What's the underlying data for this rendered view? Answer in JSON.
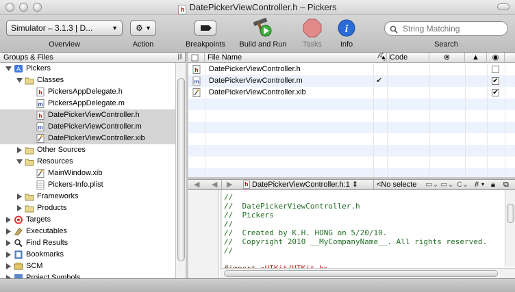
{
  "window": {
    "title": "DatePickerViewController.h – Pickers",
    "doc_badge": "h"
  },
  "toolbar": {
    "overview_value": "Simulator – 3.1.3 | D...",
    "overview_label": "Overview",
    "action_label": "Action",
    "breakpoints_label": "Breakpoints",
    "build_run_label": "Build and Run",
    "tasks_label": "Tasks",
    "info_label": "Info",
    "search_placeholder": "String Matching",
    "search_label": "Search"
  },
  "sidebar": {
    "header": "Groups & Files",
    "items": [
      {
        "label": "Pickers",
        "icon": "project-icon",
        "disclosure": "open"
      },
      {
        "label": "Classes",
        "icon": "folder-icon",
        "disclosure": "open"
      },
      {
        "label": "PickersAppDelegate.h",
        "icon": "header-file-icon",
        "badge": "h"
      },
      {
        "label": "PickersAppDelegate.m",
        "icon": "source-file-icon",
        "badge": "m"
      },
      {
        "label": "DatePickerViewController.h",
        "icon": "header-file-icon",
        "badge": "h"
      },
      {
        "label": "DatePickerViewController.m",
        "icon": "source-file-icon",
        "badge": "m"
      },
      {
        "label": "DatePickerViewController.xib",
        "icon": "xib-file-icon",
        "badge": ""
      },
      {
        "label": "Other Sources",
        "icon": "folder-icon",
        "disclosure": "closed"
      },
      {
        "label": "Resources",
        "icon": "folder-icon",
        "disclosure": "open"
      },
      {
        "label": "MainWindow.xib",
        "icon": "xib-file-icon",
        "badge": ""
      },
      {
        "label": "Pickers-Info.plist",
        "icon": "plist-file-icon",
        "badge": ""
      },
      {
        "label": "Frameworks",
        "icon": "folder-icon",
        "disclosure": "closed"
      },
      {
        "label": "Products",
        "icon": "folder-icon",
        "disclosure": "closed"
      },
      {
        "label": "Targets",
        "icon": "target-icon",
        "disclosure": "closed"
      },
      {
        "label": "Executables",
        "icon": "executable-icon",
        "disclosure": "closed"
      },
      {
        "label": "Find Results",
        "icon": "magnifier-icon",
        "disclosure": "closed"
      },
      {
        "label": "Bookmarks",
        "icon": "bookmark-icon",
        "disclosure": "closed"
      },
      {
        "label": "SCM",
        "icon": "scm-icon",
        "disclosure": "closed"
      },
      {
        "label": "Project Symbols",
        "icon": "symbols-icon",
        "disclosure": "closed"
      }
    ]
  },
  "file_table": {
    "col_filename": "File Name",
    "col_code": "Code",
    "rows": [
      {
        "name": "DatePickerViewController.h",
        "badge": "h",
        "build_check": "",
        "target_checked": false
      },
      {
        "name": "DatePickerViewController.m",
        "badge": "m",
        "build_check": "✔",
        "target_checked": true
      },
      {
        "name": "DatePickerViewController.xib",
        "badge": "",
        "build_check": "",
        "target_checked": true
      }
    ],
    "check_mark": "✔"
  },
  "editor_nav": {
    "file_selector": "DatePickerViewController.h:1 ⇕",
    "symbol_selector": "<No selecte",
    "hash": "#"
  },
  "editor": {
    "lines": [
      {
        "cls": "cmt",
        "text": "//"
      },
      {
        "cls": "cmt",
        "text": "//  DatePickerViewController.h"
      },
      {
        "cls": "cmt",
        "text": "//  Pickers"
      },
      {
        "cls": "cmt",
        "text": "//"
      },
      {
        "cls": "cmt",
        "text": "//  Created by K.H. HONG on 5/20/10."
      },
      {
        "cls": "cmt",
        "text": "//  Copyright 2010 __MyCompanyName__. All rights reserved."
      },
      {
        "cls": "cmt",
        "text": "//"
      },
      {
        "cls": "",
        "text": ""
      },
      {
        "cls": "pp",
        "text": "#import ",
        "tail": "<UIKit/UIKit.h>"
      }
    ]
  },
  "colors": {
    "selection": "#d4d4d4",
    "alt_row": "#edf3fe",
    "comment": "#236e25",
    "tasks_red": "#d94a4a",
    "info_blue": "#2a6bd6"
  }
}
